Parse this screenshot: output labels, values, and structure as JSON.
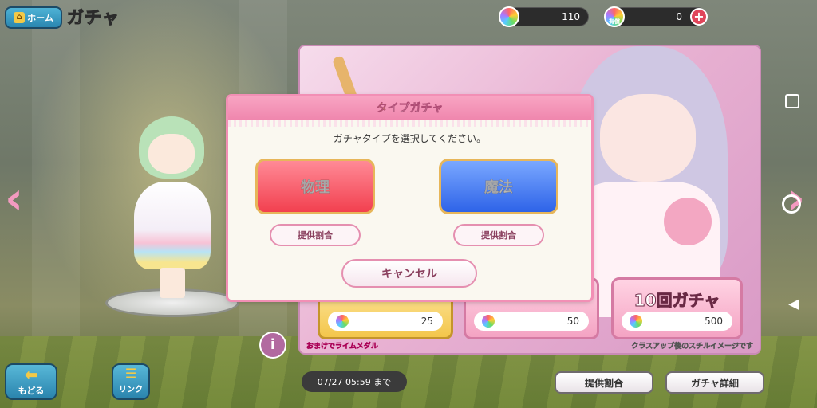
{
  "header": {
    "home_label": "ホーム",
    "title": "ガチャ"
  },
  "currency": {
    "free_gems": "110",
    "paid_gems": "0",
    "paid_badge": "有償"
  },
  "banner": {
    "pulls": [
      {
        "cost": "25",
        "badge": "有償"
      },
      {
        "cost": "50"
      },
      {
        "label": "10回ガチャ",
        "cost": "500"
      }
    ],
    "bonus_text": "おまけでライムメダル",
    "note_text": "クラスアップ後のスチルイメージです"
  },
  "dialog": {
    "title_first": "タ",
    "title_rest": "イプガチャ",
    "message": "ガチャタイプを選択してください。",
    "physical_label": "物理",
    "magic_label": "魔法",
    "rate_label_physical": "提供割合",
    "rate_label_magic": "提供割合",
    "cancel_label": "キャンセル"
  },
  "footer": {
    "back_label": "もどる",
    "link_label": "リンク",
    "deadline": "07/27 05:59 まで",
    "rates_label": "提供割合",
    "details_label": "ガチャ詳細"
  },
  "colors": {
    "accent_pink": "#f28fb5",
    "physical_red": "#f2404f",
    "magic_blue": "#2e63e8"
  }
}
